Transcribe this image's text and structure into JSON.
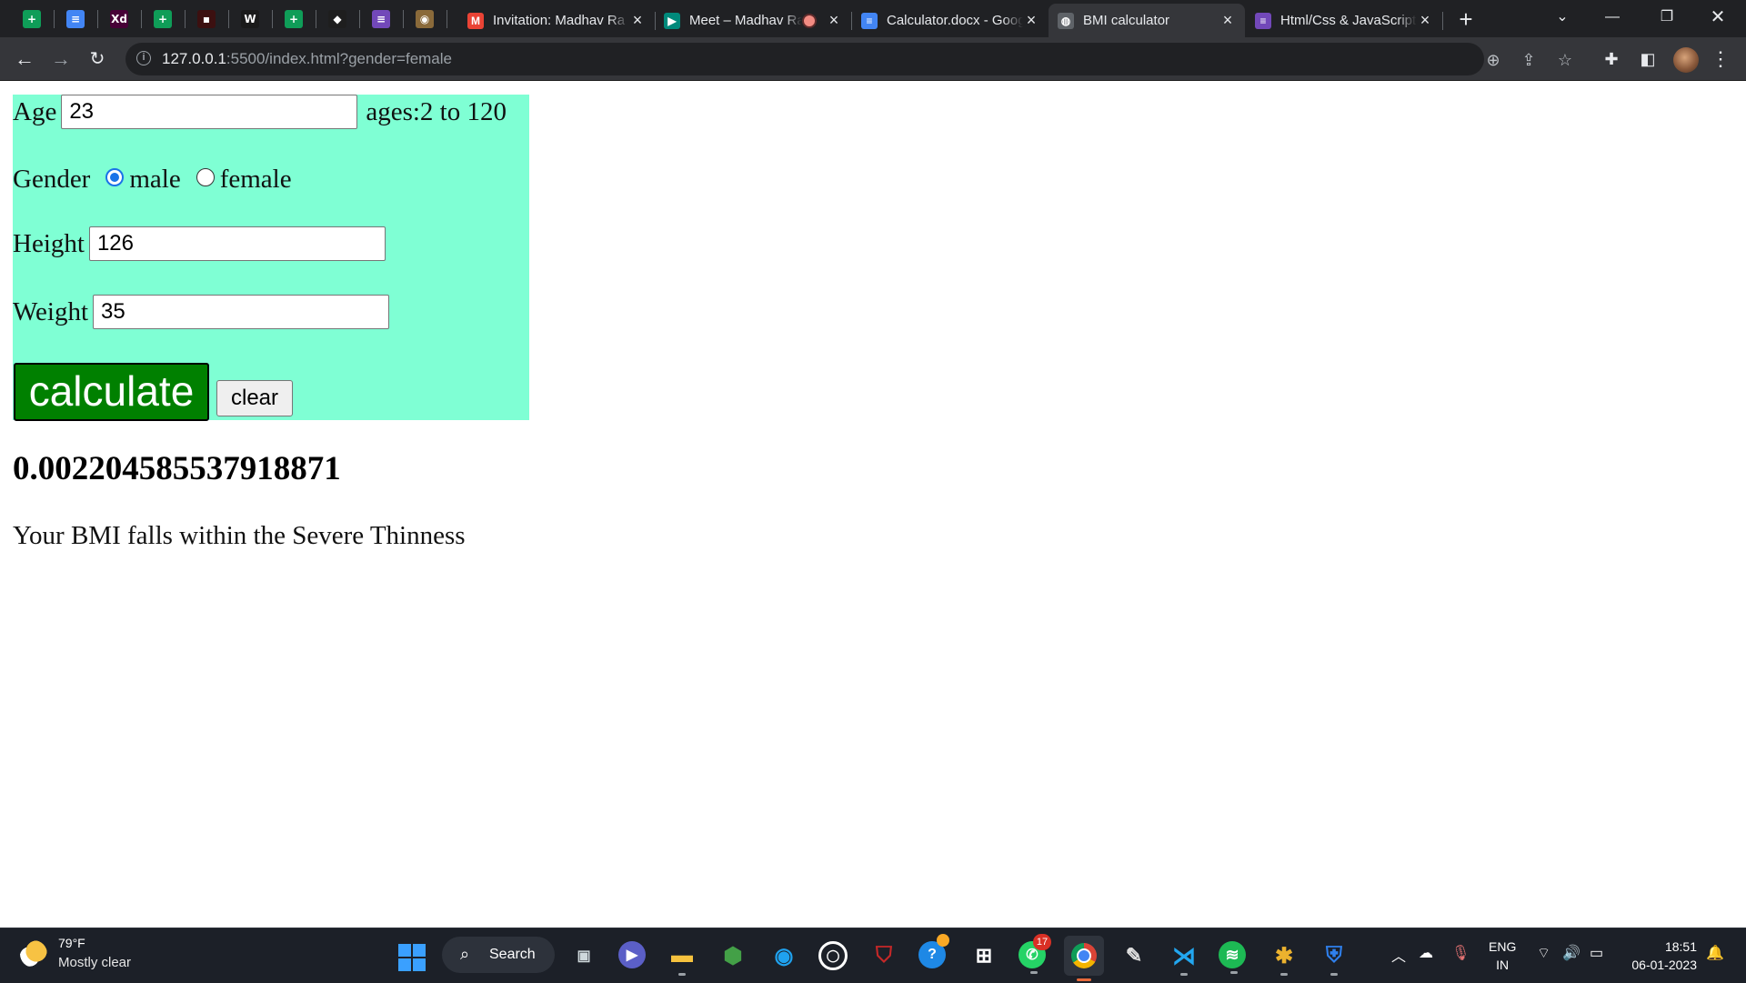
{
  "browser": {
    "pinned_tabs": [
      {
        "icon": "google-sheets-icon",
        "color": "#0f9d58",
        "glyph": "+"
      },
      {
        "icon": "google-docs-icon",
        "color": "#4285f4",
        "glyph": "≡"
      },
      {
        "icon": "adobe-xd-icon",
        "color": "#470137",
        "glyph": "Xd"
      },
      {
        "icon": "google-sheets-icon",
        "color": "#0f9d58",
        "glyph": "+"
      },
      {
        "icon": "red-app-icon",
        "color": "#3c1010",
        "glyph": "▪"
      },
      {
        "icon": "webflow-icon",
        "color": "#1a1a1a",
        "glyph": "W"
      },
      {
        "icon": "google-sheets-icon",
        "color": "#0f9d58",
        "glyph": "+"
      },
      {
        "icon": "figma-icon",
        "color": "#1e1e1e",
        "glyph": "◆"
      },
      {
        "icon": "google-forms-icon",
        "color": "#7248b9",
        "glyph": "≡"
      },
      {
        "icon": "profile-image-icon",
        "color": "#8a6a3a",
        "glyph": "◉"
      }
    ],
    "tabs": [
      {
        "title": "Invitation: Madhav Ra",
        "icon": "gmail-icon",
        "color": "#ea4335",
        "glyph": "M"
      },
      {
        "title": "Meet – Madhav Ra",
        "icon": "google-meet-icon",
        "color": "#00897b",
        "glyph": "▶"
      },
      {
        "title": "Calculator.docx - Google Docs",
        "icon": "google-docs-icon",
        "color": "#4285f4",
        "glyph": "≡"
      },
      {
        "title": "BMI calculator",
        "icon": "globe-icon",
        "color": "#5f6368",
        "glyph": "◍"
      },
      {
        "title": "Html/Css & JavaScript",
        "icon": "google-forms-icon",
        "color": "#7248b9",
        "glyph": "≡"
      }
    ],
    "url_host": "127.0.0.1",
    "url_rest": ":5500/index.html?gender=female"
  },
  "form": {
    "age_label": "Age",
    "age_value": "23",
    "age_hint": "ages:2 to 120",
    "gender_label": "Gender",
    "male_label": "male",
    "female_label": "female",
    "gender_selected": "male",
    "height_label": "Height",
    "height_value": "126",
    "weight_label": "Weight",
    "weight_value": "35",
    "calculate_label": "calculate",
    "clear_label": "clear",
    "panel_color": "#7fffd4",
    "calculate_color": "#008000"
  },
  "result": {
    "value": "0.002204585537918871",
    "message": "Your BMI falls within the Severe Thinness"
  },
  "taskbar": {
    "weather_temp": "79°F",
    "weather_desc": "Mostly clear",
    "search_label": "Search",
    "whatsapp_badge": "17",
    "lang_line1": "ENG",
    "lang_line2": "IN",
    "time": "18:51",
    "date": "06-01-2023"
  }
}
